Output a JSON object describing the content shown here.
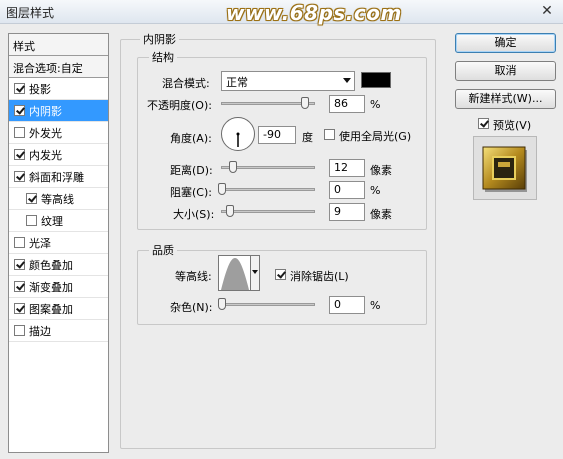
{
  "window": {
    "title": "图层样式",
    "watermark": "www.68ps.com",
    "close_glyph": "✕"
  },
  "styles_list": {
    "header": "样式",
    "blend_options": "混合选项:自定",
    "items": [
      {
        "label": "投影",
        "checked": true,
        "selected": false,
        "sub": false
      },
      {
        "label": "内阴影",
        "checked": true,
        "selected": true,
        "sub": false
      },
      {
        "label": "外发光",
        "checked": false,
        "selected": false,
        "sub": false
      },
      {
        "label": "内发光",
        "checked": true,
        "selected": false,
        "sub": false
      },
      {
        "label": "斜面和浮雕",
        "checked": true,
        "selected": false,
        "sub": false
      },
      {
        "label": "等高线",
        "checked": true,
        "selected": false,
        "sub": true
      },
      {
        "label": "纹理",
        "checked": false,
        "selected": false,
        "sub": true
      },
      {
        "label": "光泽",
        "checked": false,
        "selected": false,
        "sub": false
      },
      {
        "label": "颜色叠加",
        "checked": true,
        "selected": false,
        "sub": false
      },
      {
        "label": "渐变叠加",
        "checked": true,
        "selected": false,
        "sub": false
      },
      {
        "label": "图案叠加",
        "checked": true,
        "selected": false,
        "sub": false
      },
      {
        "label": "描边",
        "checked": false,
        "selected": false,
        "sub": false
      }
    ]
  },
  "inner_shadow": {
    "section_title": "内阴影",
    "structure": {
      "title": "结构",
      "blend_mode_label": "混合模式:",
      "blend_mode_value": "正常",
      "shadow_color": "#000000",
      "opacity_label": "不透明度(O):",
      "opacity_value": "86",
      "opacity_unit": "%",
      "angle_label": "角度(A):",
      "angle_value": "-90",
      "angle_unit": "度",
      "global_light_label": "使用全局光(G)",
      "global_light_checked": false,
      "distance_label": "距离(D):",
      "distance_value": "12",
      "distance_unit": "像素",
      "choke_label": "阻塞(C):",
      "choke_value": "0",
      "choke_unit": "%",
      "size_label": "大小(S):",
      "size_value": "9",
      "size_unit": "像素"
    },
    "quality": {
      "title": "品质",
      "contour_label": "等高线:",
      "antialias_label": "消除锯齿(L)",
      "antialias_checked": true,
      "noise_label": "杂色(N):",
      "noise_value": "0",
      "noise_unit": "%"
    }
  },
  "buttons": {
    "ok": "确定",
    "cancel": "取消",
    "new_style": "新建样式(W)...",
    "preview_label": "预览(V)",
    "preview_checked": true
  }
}
